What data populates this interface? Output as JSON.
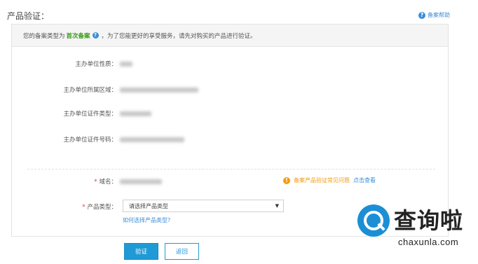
{
  "header": {
    "title": "产品验证：",
    "help_link": "备案帮助"
  },
  "notice": {
    "prefix": "您的备案类型为",
    "type": "首次备案",
    "suffix": "，为了您能更好的享受服务，请先对购买的产品进行验证。"
  },
  "info_rows": [
    {
      "label": "主办单位性质："
    },
    {
      "label": "主办单位所属区域："
    },
    {
      "label": "主办单位证件类型："
    },
    {
      "label": "主办单位证件号码："
    }
  ],
  "form": {
    "domain_label": "域名：",
    "product_type_label": "产品类型：",
    "product_type_value": "请选择产品类型",
    "how_to_choose": "如何选择产品类型?",
    "faq_text": "备案产品验证常见问题",
    "faq_link": "点击查看"
  },
  "buttons": {
    "verify": "验证",
    "back": "返回"
  },
  "watermark": {
    "cn": "查询啦",
    "en": "chaxunla.com"
  },
  "colors": {
    "accent": "#1f9ad6",
    "highlight_green": "#3a9a1c",
    "warning_orange": "#f39c12",
    "required_red": "#e4393c"
  }
}
